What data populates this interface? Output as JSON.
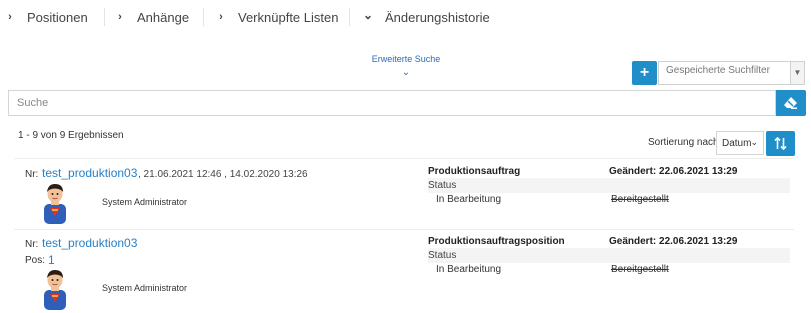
{
  "tabs": [
    {
      "label": "Positionen",
      "chevron": "›",
      "expanded": false
    },
    {
      "label": "Anhänge",
      "chevron": "›",
      "expanded": false
    },
    {
      "label": "Verknüpfte Listen",
      "chevron": "›",
      "expanded": false
    },
    {
      "label": "Änderungshistorie",
      "chevron": "⌄",
      "expanded": true
    }
  ],
  "extended_search": {
    "label": "Erweiterte Suche",
    "icon": "chevron-down-icon"
  },
  "saved_filter": {
    "add_icon": "+",
    "placeholder": "Gespeicherte Suchfilter"
  },
  "search": {
    "placeholder": "Suche",
    "value": "",
    "clear_icon": "eraser-icon"
  },
  "results": {
    "count_text": "1 - 9 von 9 Ergebnissen"
  },
  "sort": {
    "label": "Sortierung nach",
    "value": "Datum",
    "direction_icon": "sort-direction-icon"
  },
  "colors": {
    "accent": "#1f8ec9",
    "link": "#2a80c5"
  },
  "entries": [
    {
      "nr_label": "Nr:",
      "nr": "test_produktion03",
      "dates": ", 21.06.2021 12:46 , 14.02.2020 13:26",
      "user": "System Administrator",
      "object_type": "Produktionsauftrag",
      "changed": "Geändert:  22.06.2021 13:29",
      "field": "Status",
      "new_value": "In Bearbeitung",
      "old_value": "Bereitgestellt"
    },
    {
      "nr_label": "Nr:",
      "nr": "test_produktion03",
      "pos_label": "Pos:",
      "pos": "1",
      "user": "System Administrator",
      "object_type": "Produktionsauftragsposition",
      "changed": "Geändert:  22.06.2021 13:29",
      "field": "Status",
      "new_value": "In Bearbeitung",
      "old_value": "Bereitgestellt"
    }
  ]
}
